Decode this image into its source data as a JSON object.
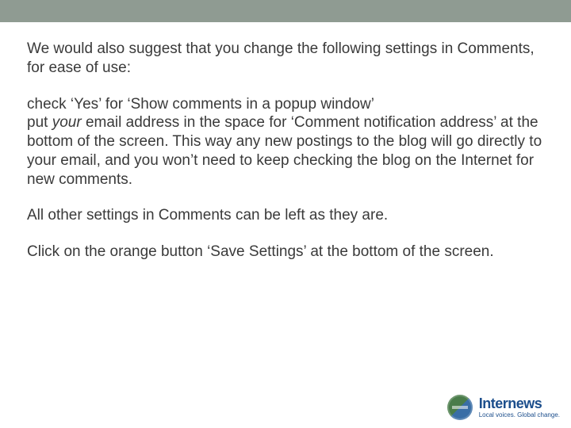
{
  "intro": "We would also suggest that you change the following settings in Comments, for ease of use:",
  "step1": "check ‘Yes’ for ‘Show comments in a popup window’",
  "step2_pre": "put ",
  "step2_em": "your",
  "step2_post": " email address in the space for ‘Comment notification address’ at the bottom of the screen. This way any new postings to the blog will go directly to your email, and you won’t need to keep checking the blog on the Internet for new comments.",
  "other": "All other settings in Comments can be left as they are.",
  "save": "Click on the orange button ‘Save Settings’ at the bottom of the screen.",
  "logo": {
    "name": "Internews",
    "tagline": "Local voices. Global change."
  }
}
